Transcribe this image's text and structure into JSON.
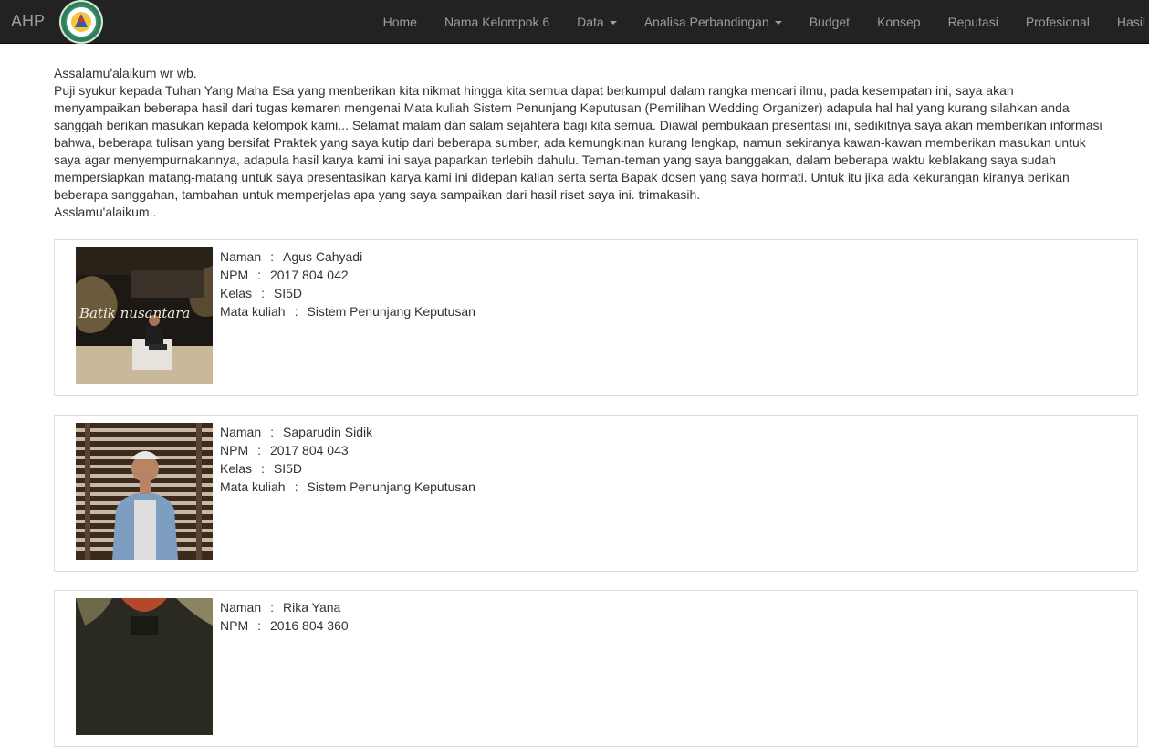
{
  "navbar": {
    "brand": "AHP",
    "items": [
      {
        "label": "Home",
        "dropdown": false
      },
      {
        "label": "Nama Kelompok 6",
        "dropdown": false
      },
      {
        "label": "Data",
        "dropdown": true
      },
      {
        "label": "Analisa Perbandingan",
        "dropdown": true
      },
      {
        "label": "Budget",
        "dropdown": false
      },
      {
        "label": "Konsep",
        "dropdown": false
      },
      {
        "label": "Reputasi",
        "dropdown": false
      },
      {
        "label": "Profesional",
        "dropdown": false
      },
      {
        "label": "Hasil",
        "dropdown": false
      }
    ]
  },
  "intro": {
    "greeting": "Assalamu'alaikum wr wb.",
    "body": "Puji syukur kepada Tuhan Yang Maha Esa yang menberikan kita nikmat hingga kita semua dapat berkumpul dalam rangka mencari ilmu, pada kesempatan ini, saya akan menyampaikan beberapa hasil dari tugas kemaren mengenai Mata kuliah Sistem Penunjang Keputusan (Pemilihan Wedding Organizer) adapula hal hal yang kurang silahkan anda sanggah berikan masukan kepada kelompok kami... Selamat malam dan salam sejahtera bagi kita semua. Diawal pembukaan presentasi ini, sedikitnya saya akan memberikan informasi bahwa, beberapa tulisan yang bersifat Praktek yang saya kutip dari beberapa sumber, ada kemungkinan kurang lengkap, namun sekiranya kawan-kawan memberikan masukan untuk saya agar menyempurnakannya, adapula hasil karya kami ini saya paparkan terlebih dahulu. Teman-teman yang saya banggakan, dalam beberapa waktu keblakang saya sudah mempersiapkan matang-matang untuk saya presentasikan karya kami ini didepan kalian serta serta Bapak dosen yang saya hormati. Untuk itu jika ada kekurangan kiranya berikan beberapa sanggahan, tambahan untuk memperjelas apa yang saya sampaikan dari hasil riset saya ini. trimakasih.",
    "closing": "Asslamu'alaikum.."
  },
  "labels": {
    "name": "Naman",
    "npm": "NPM",
    "kelas": "Kelas",
    "matkul": "Mata kuliah",
    "sep": ":"
  },
  "members": [
    {
      "name": "Agus Cahyadi",
      "npm": "2017 804 042",
      "kelas": "SI5D",
      "matkul": "Sistem Penunjang Keputusan",
      "photo_text": "Batik nusantara"
    },
    {
      "name": "Saparudin Sidik",
      "npm": "2017 804 043",
      "kelas": "SI5D",
      "matkul": "Sistem Penunjang Keputusan"
    },
    {
      "name": "Rika Yana",
      "npm": "2016 804 360",
      "kelas": "",
      "matkul": ""
    }
  ]
}
